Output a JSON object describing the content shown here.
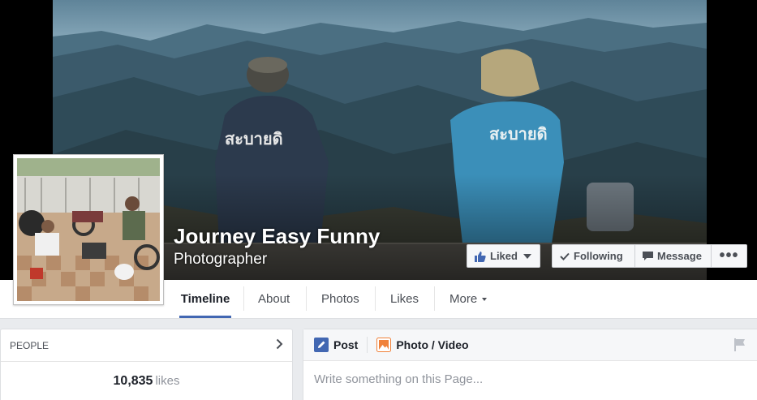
{
  "page": {
    "name": "Journey Easy Funny",
    "category": "Photographer",
    "cover_shirt_text": "สะบายดี"
  },
  "actions": {
    "liked_label": "Liked",
    "following_label": "Following",
    "message_label": "Message",
    "more_label": "•••"
  },
  "nav": {
    "tabs": [
      {
        "label": "Timeline",
        "active": true
      },
      {
        "label": "About"
      },
      {
        "label": "Photos"
      },
      {
        "label": "Likes"
      },
      {
        "label": "More"
      }
    ]
  },
  "people": {
    "header": "PEOPLE",
    "count": "10,835",
    "count_unit": "likes"
  },
  "composer": {
    "post_label": "Post",
    "photo_label": "Photo / Video",
    "placeholder": "Write something on this Page..."
  },
  "colors": {
    "accent": "#4267b2",
    "liked_icon": "#4267b2",
    "photo_icon": "#f0813a"
  },
  "icons": {
    "liked": "thumbs-up-icon",
    "following": "checkmark-icon",
    "message": "speech-bubble-icon",
    "more": "ellipsis-icon",
    "people_chevron": "chevron-right-icon",
    "post": "pencil-icon",
    "photo": "photo-icon",
    "flag": "flag-icon"
  }
}
